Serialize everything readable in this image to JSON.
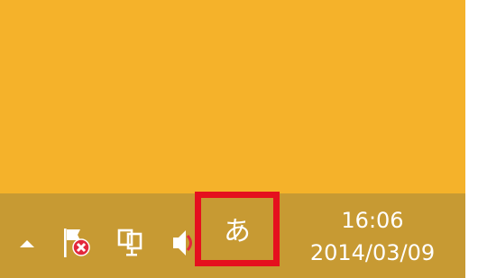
{
  "colors": {
    "desktop_background": "#f5b22a",
    "taskbar_background": "#c79a33",
    "highlight_border": "#e5101e",
    "tray_text": "#ffffff"
  },
  "tray": {
    "icons": [
      {
        "name": "show-hidden-icons",
        "glyph": "triangle-up"
      },
      {
        "name": "action-center-flag",
        "glyph": "flag-with-red-x"
      },
      {
        "name": "network",
        "glyph": "monitor-network"
      },
      {
        "name": "volume",
        "glyph": "speaker"
      }
    ],
    "ime_mode": "あ"
  },
  "clock": {
    "time": "16:06",
    "date": "2014/03/09"
  }
}
